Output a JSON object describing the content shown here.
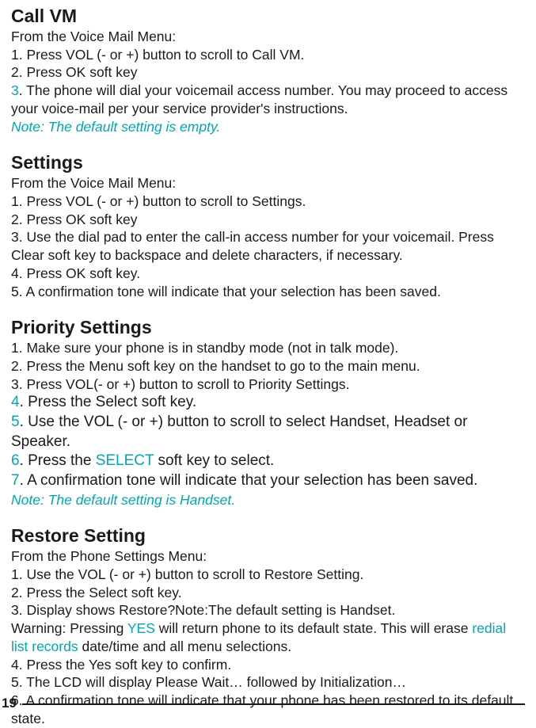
{
  "sec1": {
    "title": "Call VM",
    "intro": "From the Voice Mail Menu:",
    "l1": "1. Press VOL (- or +) button to scroll to Call VM.",
    "l2": "2. Press OK soft key",
    "l3num": "3",
    "l3rest": ". The phone will dial your voicemail access number. You may proceed to access your voice-mail per your service provider's instructions.",
    "note": "Note: The default setting is empty."
  },
  "sec2": {
    "title": "Settings",
    "intro": "From the Voice Mail Menu:",
    "l1": "1. Press VOL (- or +) button to scroll to Settings.",
    "l2": "2. Press OK soft key",
    "l3": "3. Use the dial pad to enter the call-in access number for your voicemail. Press Clear soft key to backspace and delete characters, if necessary.",
    "l4": "4. Press OK soft key.",
    "l5": "5. A confirmation tone will indicate that your selection has been saved."
  },
  "sec3": {
    "title": "Priority Settings",
    "l1": "1. Make sure your phone is in standby mode (not in talk mode).",
    "l2": "2. Press the Menu soft key on the handset to go to the main menu.",
    "l3": "3. Press VOL(- or +) button to scroll to Priority Settings.",
    "l4num": "4",
    "l4rest": ". Press the Select soft key.",
    "l5num": "5",
    "l5rest": ". Use the VOL (- or +) button to scroll to select Handset, Headset or Speaker.",
    "l6num": "6",
    "l6a": ". Press the ",
    "l6sel": "SELECT",
    "l6b": " soft key to select.",
    "l7num": "7",
    "l7rest": ". A confirmation tone will indicate that your selection has been saved.",
    "note": "Note: The default setting is Handset."
  },
  "sec4": {
    "title": "Restore Setting",
    "intro": "From the Phone Settings Menu:",
    "l1": "1. Use the VOL (- or +) button to scroll to Restore Setting.",
    "l2": "2. Press the Select soft key.",
    "l3": "3. Display shows Restore?Note:The default setting is Handset.",
    "lw_a": "Warning: Pressing ",
    "lw_yes": "YES",
    "lw_b": " will return phone to its default state. This will erase ",
    "lw_red": "redial list records",
    "lw_c": " date/time and all menu selections.",
    "l4": "4. Press the Yes soft key to confirm.",
    "l5": "5. The LCD will display Please Wait… followed by Initialization…",
    "l6": "6. A confirmation tone will indicate that your phone has been restored to its default state."
  },
  "page": "19"
}
